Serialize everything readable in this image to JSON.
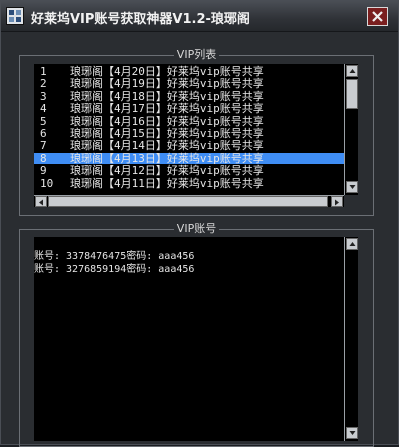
{
  "window": {
    "title": "好莱坞VIP账号获取神器V1.2-琅琊阁"
  },
  "vip_list": {
    "group_title": "VIP列表",
    "rows": [
      {
        "num": "1",
        "text": "琅琊阁【4月20日】好莱坞vip账号共享"
      },
      {
        "num": "2",
        "text": "琅琊阁【4月19日】好莱坞vip账号共享"
      },
      {
        "num": "3",
        "text": "琅琊阁【4月18日】好莱坞vip账号共享"
      },
      {
        "num": "4",
        "text": "琅琊阁【4月17日】好莱坞vip账号共享"
      },
      {
        "num": "5",
        "text": "琅琊阁【4月16日】好莱坞vip账号共享"
      },
      {
        "num": "6",
        "text": "琅琊阁【4月15日】好莱坞vip账号共享"
      },
      {
        "num": "7",
        "text": "琅琊阁【4月14日】好莱坞vip账号共享"
      },
      {
        "num": "8",
        "text": "琅琊阁【4月13日】好莱坞vip账号共享"
      },
      {
        "num": "9",
        "text": "琅琊阁【4月12日】好莱坞vip账号共享"
      },
      {
        "num": "10",
        "text": "琅琊阁【4月11日】好莱坞vip账号共享"
      }
    ],
    "selected_index": 7
  },
  "vip_accounts": {
    "group_title": "VIP账号",
    "lines": [
      "账号: 3378476475密码: aaa456",
      "账号: 3276859194密码: aaa456"
    ]
  },
  "colors": {
    "selection": "#3f8df4",
    "close_button": "#7a1f1f"
  },
  "icons": {
    "app": "app-logo-icon",
    "close": "close-icon",
    "scroll_up": "scroll-up-arrow-icon",
    "scroll_down": "scroll-down-arrow-icon",
    "scroll_left": "scroll-left-arrow-icon",
    "scroll_right": "scroll-right-arrow-icon"
  }
}
